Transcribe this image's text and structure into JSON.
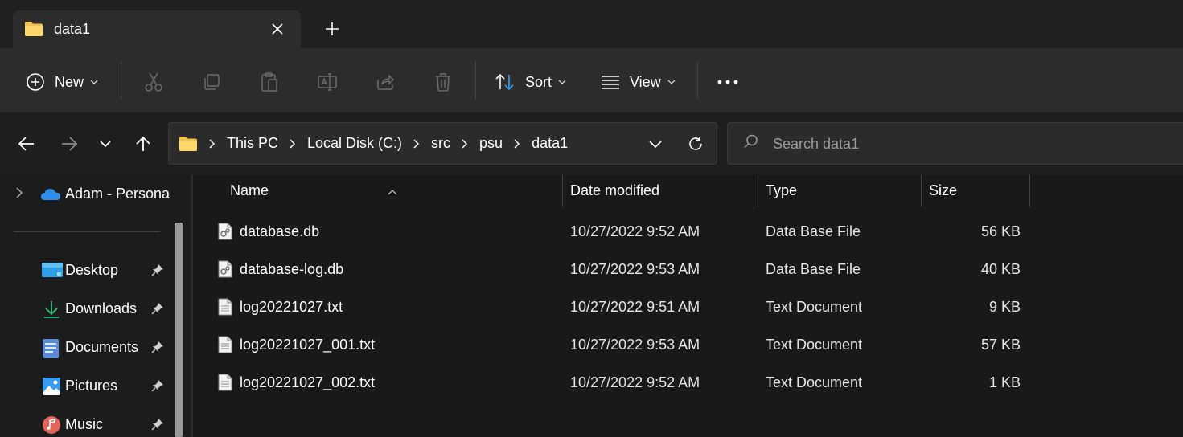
{
  "tab": {
    "title": "data1"
  },
  "toolbar": {
    "new_label": "New",
    "sort_label": "Sort",
    "view_label": "View"
  },
  "address": {
    "breadcrumbs": [
      "This PC",
      "Local Disk (C:)",
      "src",
      "psu",
      "data1"
    ]
  },
  "search": {
    "placeholder": "Search data1"
  },
  "sidebar": {
    "onedrive_label": "Adam - Persona",
    "quick_access": [
      {
        "label": "Desktop",
        "icon": "desktop-icon"
      },
      {
        "label": "Downloads",
        "icon": "downloads-icon"
      },
      {
        "label": "Documents",
        "icon": "documents-icon"
      },
      {
        "label": "Pictures",
        "icon": "pictures-icon"
      },
      {
        "label": "Music",
        "icon": "music-icon"
      }
    ]
  },
  "columns": {
    "name": "Name",
    "date": "Date modified",
    "type": "Type",
    "size": "Size"
  },
  "files": [
    {
      "name": "database.db",
      "date": "10/27/2022 9:52 AM",
      "type": "Data Base File",
      "size": "56 KB",
      "icon": "db-file-icon"
    },
    {
      "name": "database-log.db",
      "date": "10/27/2022 9:53 AM",
      "type": "Data Base File",
      "size": "40 KB",
      "icon": "db-file-icon"
    },
    {
      "name": "log20221027.txt",
      "date": "10/27/2022 9:51 AM",
      "type": "Text Document",
      "size": "9 KB",
      "icon": "text-file-icon"
    },
    {
      "name": "log20221027_001.txt",
      "date": "10/27/2022 9:53 AM",
      "type": "Text Document",
      "size": "57 KB",
      "icon": "text-file-icon"
    },
    {
      "name": "log20221027_002.txt",
      "date": "10/27/2022 9:52 AM",
      "type": "Text Document",
      "size": "1 KB",
      "icon": "text-file-icon"
    }
  ],
  "colors": {
    "folder": "#f3c24f",
    "accent_blue": "#3aa0f3",
    "background": "#191919"
  }
}
